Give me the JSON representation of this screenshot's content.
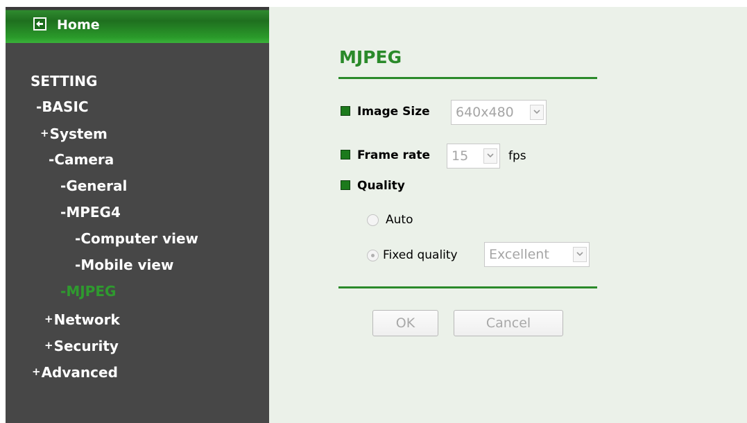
{
  "sidebar": {
    "home_label": "Home",
    "items": [
      {
        "prefix": "",
        "label": "SETTING"
      },
      {
        "prefix": "-",
        "label": "BASIC"
      },
      {
        "prefix": "+",
        "label": "System"
      },
      {
        "prefix": "-",
        "label": "Camera"
      },
      {
        "prefix": "-",
        "label": "General"
      },
      {
        "prefix": "-",
        "label": "MPEG4"
      },
      {
        "prefix": "-",
        "label": "Computer view"
      },
      {
        "prefix": "-",
        "label": "Mobile view"
      },
      {
        "prefix": "-",
        "label": "MJPEG",
        "active": true
      },
      {
        "prefix": "+",
        "label": "Network"
      },
      {
        "prefix": "+",
        "label": "Security"
      },
      {
        "prefix": "+",
        "label": "Advanced"
      }
    ]
  },
  "main": {
    "title": "MJPEG",
    "image_size": {
      "label": "Image Size",
      "value": "640x480"
    },
    "frame_rate": {
      "label": "Frame rate",
      "value": "15",
      "unit": "fps"
    },
    "quality": {
      "label": "Quality",
      "options": [
        {
          "label": "Auto",
          "selected": false
        },
        {
          "label": "Fixed quality",
          "selected": true
        }
      ],
      "fixed_value": "Excellent"
    },
    "buttons": {
      "ok": "OK",
      "cancel": "Cancel"
    }
  },
  "colors": {
    "sidebar_bg": "#474747",
    "accent_green": "#2a8a2a",
    "content_bg": "#ebf1e9"
  },
  "icons": {
    "home": "back-arrow-icon",
    "bullet": "green-square-icon",
    "dropdown": "chevron-down-icon"
  }
}
